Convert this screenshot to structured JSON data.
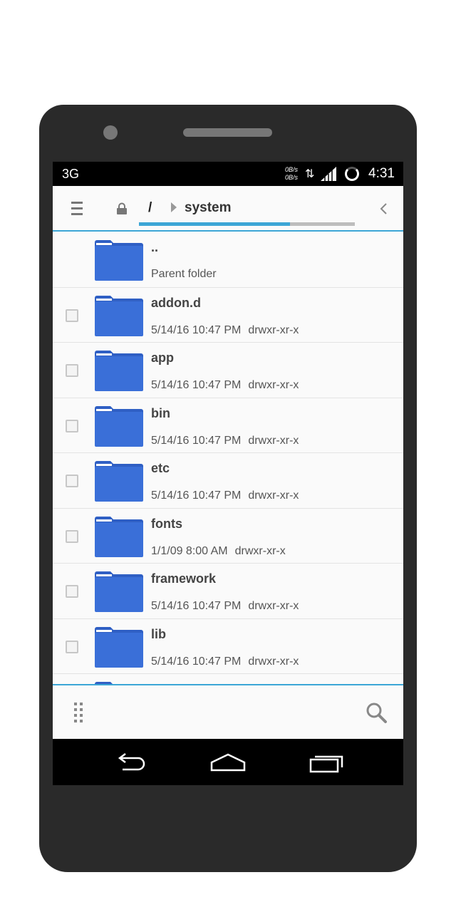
{
  "status_bar": {
    "network": "3G",
    "speed_up": "0B/s",
    "speed_down": "0B/s",
    "time": "4:31"
  },
  "toolbar": {
    "root_segment": "/",
    "current_folder": "system",
    "progress_fraction": 0.7
  },
  "files": [
    {
      "name": "..",
      "subtitle": "Parent folder",
      "is_parent": true
    },
    {
      "name": "addon.d",
      "date": "5/14/16 10:47 PM",
      "perms": "drwxr-xr-x"
    },
    {
      "name": "app",
      "date": "5/14/16 10:47 PM",
      "perms": "drwxr-xr-x"
    },
    {
      "name": "bin",
      "date": "5/14/16 10:47 PM",
      "perms": "drwxr-xr-x"
    },
    {
      "name": "etc",
      "date": "5/14/16 10:47 PM",
      "perms": "drwxr-xr-x"
    },
    {
      "name": "fonts",
      "date": "1/1/09 8:00 AM",
      "perms": "drwxr-xr-x"
    },
    {
      "name": "framework",
      "date": "5/14/16 10:47 PM",
      "perms": "drwxr-xr-x"
    },
    {
      "name": "lib",
      "date": "5/14/16 10:47 PM",
      "perms": "drwxr-xr-x"
    }
  ],
  "colors": {
    "accent": "#3ca6d6",
    "folder": "#3a6fd8",
    "folder_tab": "#2f5fc4"
  },
  "icons": {
    "menu": "hamburger-menu-icon",
    "lock": "lock-icon",
    "breadcrumb": "chevron-right-icon",
    "back": "chevron-left-icon",
    "drag": "grip-icon",
    "search": "search-icon",
    "nav_back": "back-arrow-icon",
    "nav_home": "home-icon",
    "nav_recents": "recents-icon"
  }
}
